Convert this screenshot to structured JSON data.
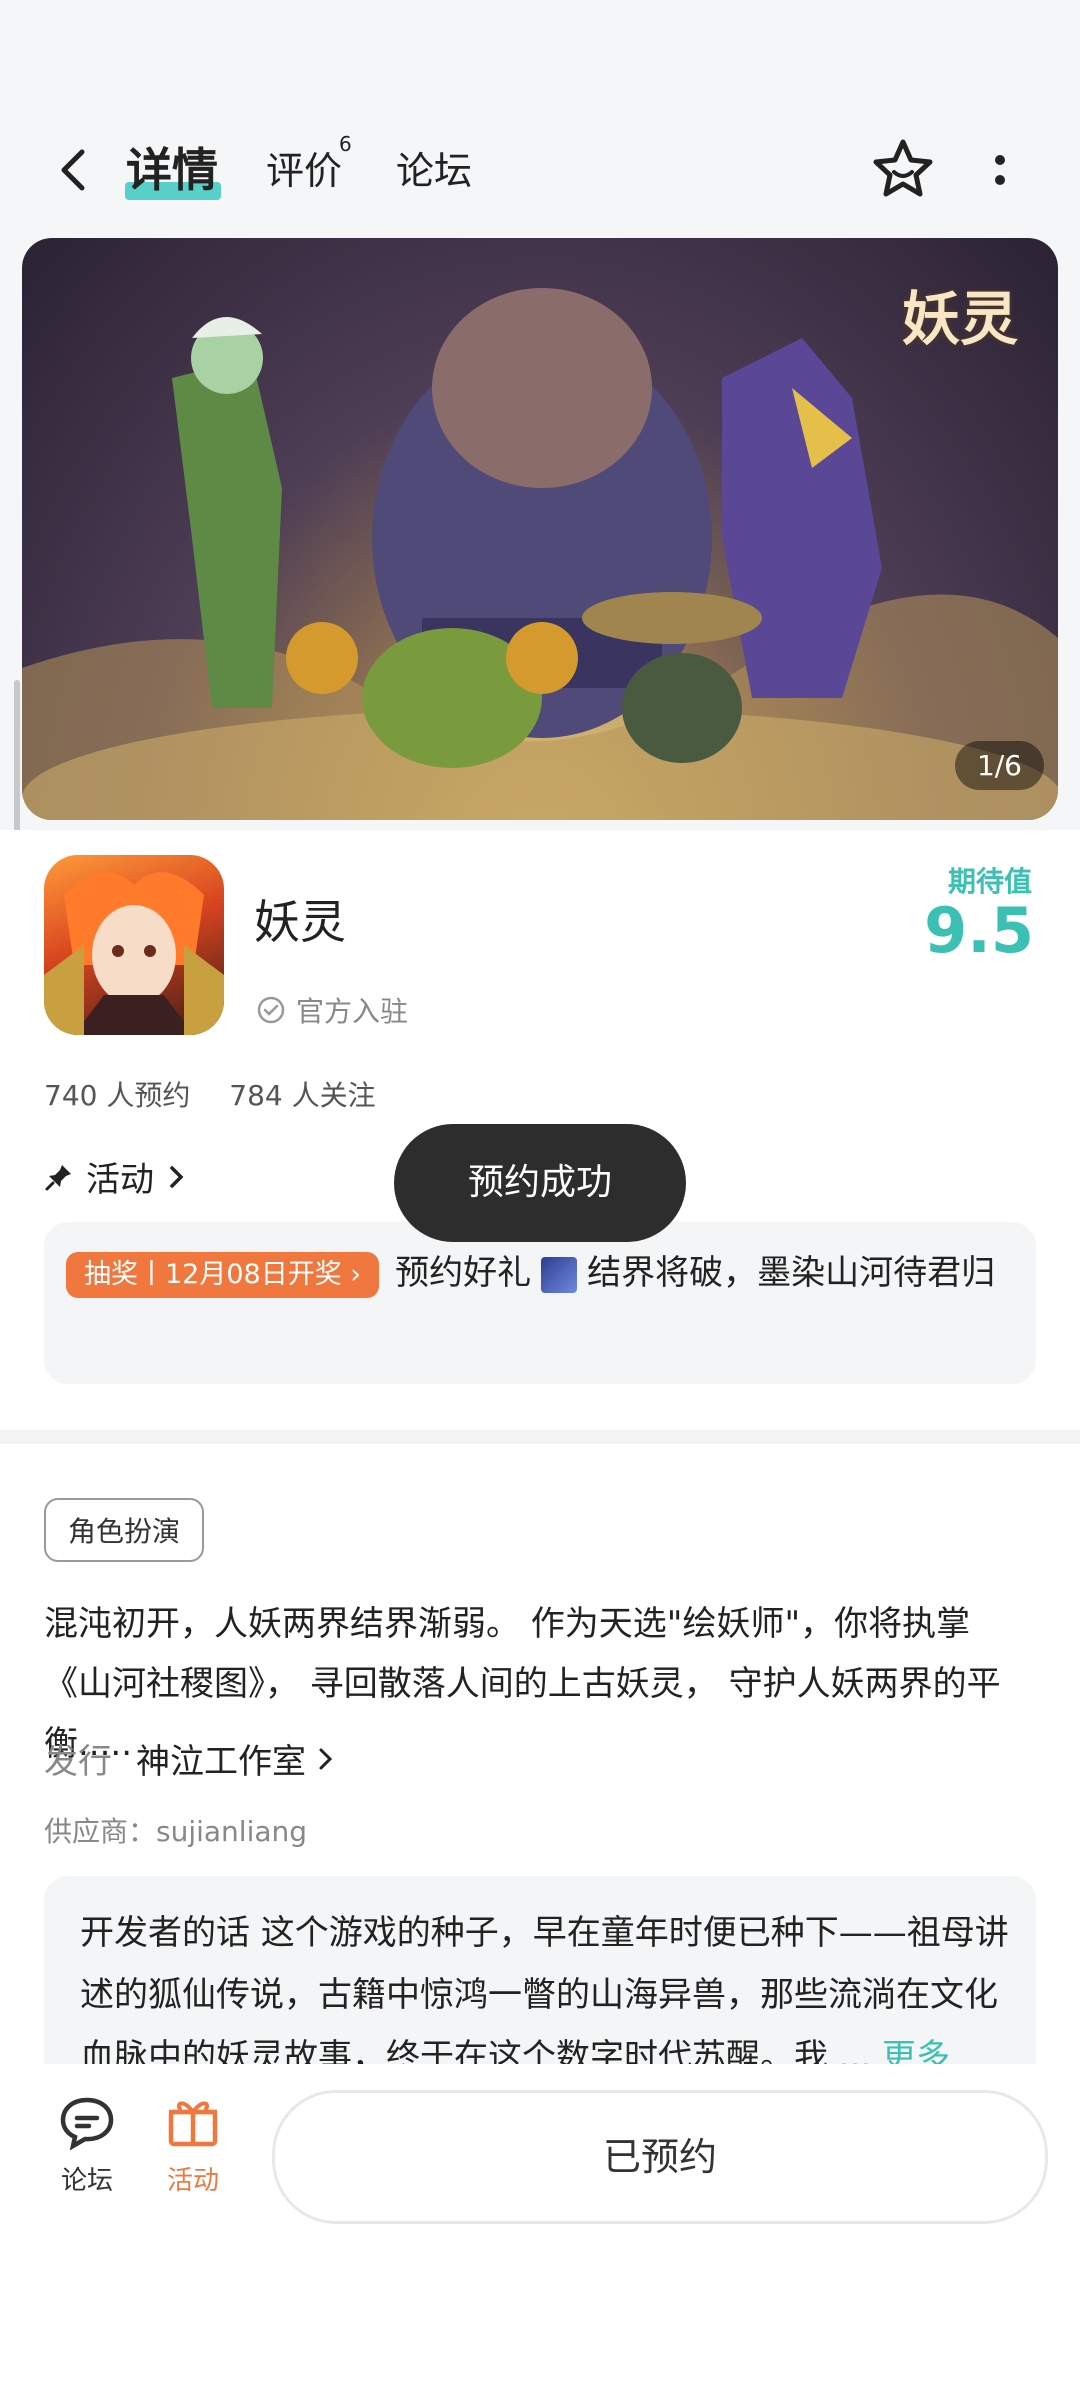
{
  "header": {
    "tabs": [
      {
        "label": "详情",
        "active": true
      },
      {
        "label": "评价",
        "badge": "6"
      },
      {
        "label": "论坛"
      }
    ]
  },
  "banner": {
    "logo_text": "妖灵",
    "counter": "1/6"
  },
  "game": {
    "name": "妖灵",
    "official_label": "官方入驻",
    "expect_label": "期待值",
    "expect_value": "9.5",
    "reservations": "740 人预约",
    "followers": "784 人关注"
  },
  "activity": {
    "heading": "活动",
    "badge": "抽奖丨12月08日开奖",
    "text_a": "预约好礼",
    "text_b": "结界将破，墨染山河待君归"
  },
  "toast": {
    "text": "预约成功"
  },
  "detail": {
    "genre": "角色扮演",
    "summary": "混沌初开，人妖两界结界渐弱。 作为天选\"绘妖师\"，你将执掌《山河社稷图》， 寻回散落人间的上古妖灵， 守护人妖两界的平衡.....",
    "publisher_label": "发行",
    "publisher_name": "神泣工作室",
    "supplier": "供应商：sujianliang",
    "dev_note": "开发者的话  这个游戏的种子，早在童年时便已种下——祖母讲述的狐仙传说，古籍中惊鸿一瞥的山海异兽，那些流淌在文化血脉中的妖灵故事，终于在这个数字时代苏醒。我 ...",
    "more_label": "更多"
  },
  "bottom": {
    "nav": [
      {
        "label": "论坛",
        "icon": "chat-icon",
        "color": "#333333"
      },
      {
        "label": "活动",
        "icon": "gift-icon",
        "color": "#f0783f"
      }
    ],
    "reserve_button": "已预约"
  },
  "colors": {
    "accent": "#3cc0b4",
    "orange": "#f0783f",
    "toast": "#2d2d2d"
  }
}
